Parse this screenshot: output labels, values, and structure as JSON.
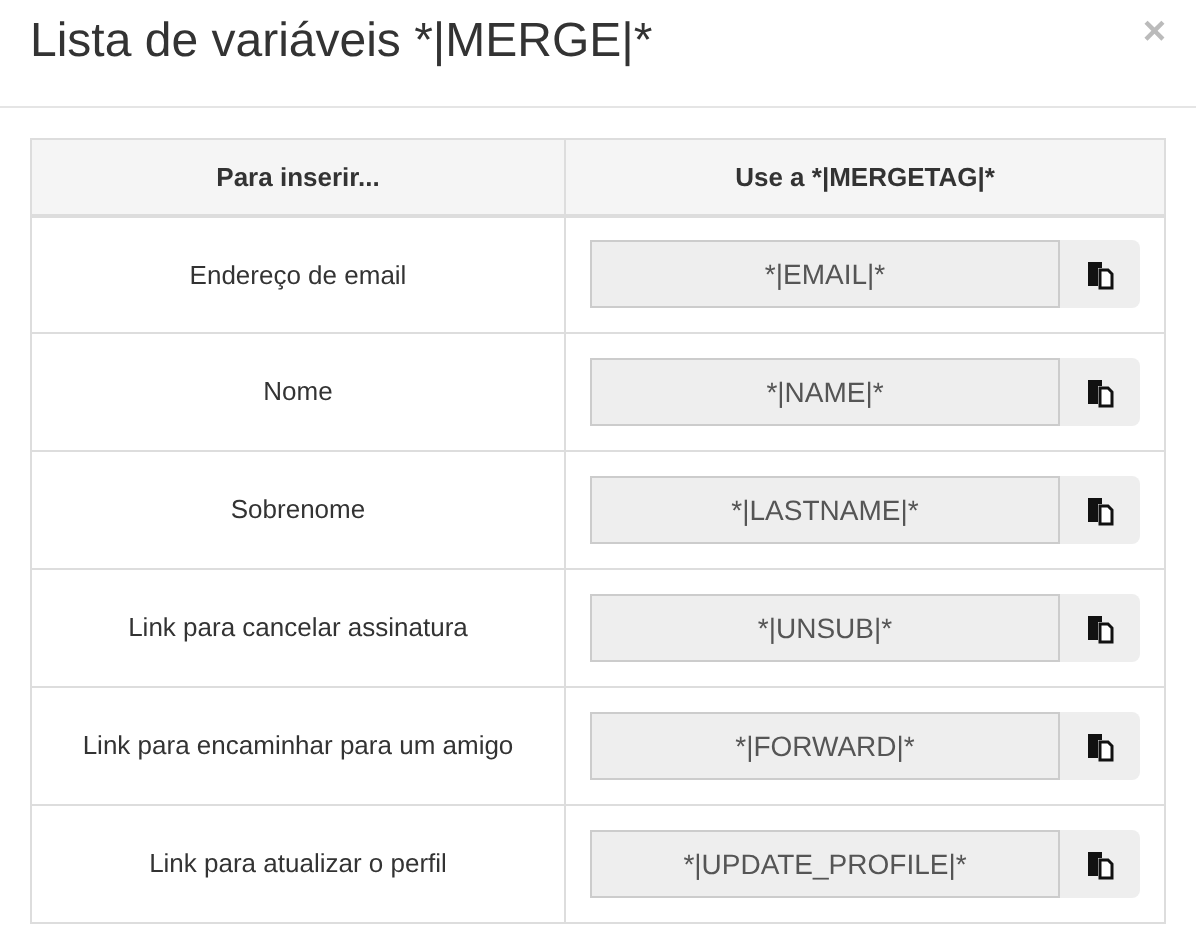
{
  "modal": {
    "title": "Lista de variáveis *|MERGE|*",
    "close": "×"
  },
  "table": {
    "columns": [
      "Para inserir...",
      "Use a *|MERGETAG|*"
    ],
    "rows": [
      {
        "label": "Endereço de email",
        "tag": "*|EMAIL|*"
      },
      {
        "label": "Nome",
        "tag": "*|NAME|*"
      },
      {
        "label": "Sobrenome",
        "tag": "*|LASTNAME|*"
      },
      {
        "label": "Link para cancelar assinatura",
        "tag": "*|UNSUB|*"
      },
      {
        "label": "Link para encaminhar para um amigo",
        "tag": "*|FORWARD|*"
      },
      {
        "label": "Link para atualizar o perfil",
        "tag": "*|UPDATE_PROFILE|*"
      }
    ]
  }
}
